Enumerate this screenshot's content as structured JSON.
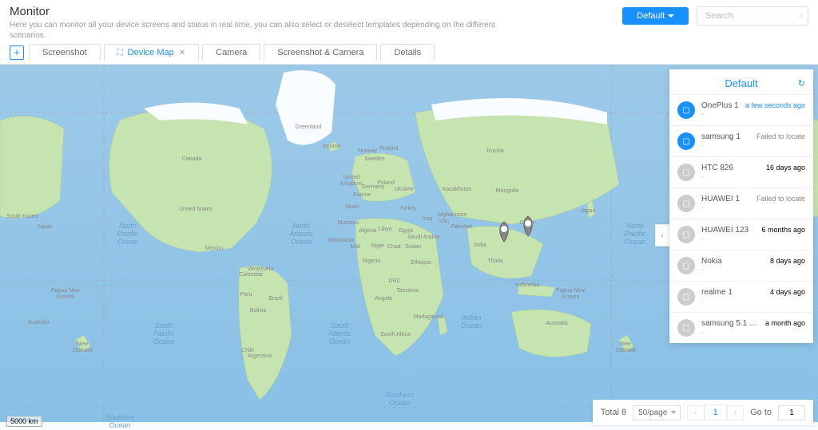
{
  "header": {
    "title": "Monitor",
    "subtitle": "Here you can monitor all your device screens and status in real time, you can also select or deselect templates depending on the different scenarios.",
    "default_btn": "Default",
    "search_placeholder": "Search"
  },
  "tabs": {
    "screenshot": "Screenshot",
    "device_map": "Device Map",
    "camera": "Camera",
    "screenshot_camera": "Screenshot & Camera",
    "details": "Details"
  },
  "map": {
    "scale": "5000 km",
    "oceans": {
      "npac": "North\nPacific\nOcean",
      "natl": "North\nAtlantic\nOcean",
      "spac": "South\nPacific\nOcean",
      "satl": "South\nAtlantic\nOcean",
      "indian": "Indian\nOcean",
      "npac2": "North\nPacific\nOcean",
      "south1": "Southern\nOcean",
      "south2": "Southern\nOcean"
    },
    "countries": {
      "greenland": "Greenland",
      "canada": "Canada",
      "us": "United States",
      "mexico": "Mexico",
      "brazil": "Brazil",
      "argentina": "Argentina",
      "russia": "Russia",
      "china": "China",
      "india": "India",
      "australia": "Australia",
      "algeria": "Algeria",
      "mali": "Mali",
      "niger": "Niger",
      "sudan": "Sudan",
      "drc": "DRC",
      "kazakhstan": "Kazakhstan",
      "mongolia": "Mongolia",
      "iran": "Iran",
      "saudi": "Saudi Arabia",
      "egypt": "Egypt",
      "libya": "Libya",
      "turkey": "Turkey",
      "ukraine": "Ukraine",
      "france": "France",
      "spain": "Spain",
      "germany": "Germany",
      "uk": "United\nKingdom",
      "poland": "Poland",
      "sweden": "Sweden",
      "norway": "Norway",
      "finland": "Finland",
      "iceland": "Iceland",
      "japan": "Japan",
      "skorea": "South Korea",
      "indonesia": "Indonesia",
      "png": "Papua New\nGuinea",
      "nz": "New\nZealand",
      "nz2": "New\nZealand",
      "chad": "Chad",
      "nigeria": "Nigeria",
      "ethiopia": "Ethiopia",
      "tanzania": "Tanzania",
      "angola": "Angola",
      "safrica": "South Africa",
      "madagascar": "Madagascar",
      "peru": "Peru",
      "bolivia": "Bolivia",
      "colombia": "Colombia",
      "venezuela": "Venezuela",
      "chile": "Chile",
      "pakistan": "Pakistan",
      "afghanistan": "Afghanistan",
      "iraq": "Iraq",
      "thai": "Thaila",
      "morocco": "Morocco",
      "mauritania": "Mauritania"
    }
  },
  "panel": {
    "title": "Default"
  },
  "devices": [
    {
      "name": "OnePlus 1",
      "sub": "-",
      "time": "a few seconds ago",
      "status": "online",
      "time_class": "recent"
    },
    {
      "name": "samsung 1",
      "sub": "-",
      "time": "Failed to locate",
      "status": "online",
      "time_class": "fail"
    },
    {
      "name": "HTC 826",
      "sub": "-",
      "time": "16 days ago",
      "status": "offline",
      "time_class": ""
    },
    {
      "name": "HUAWEI 1",
      "sub": "-",
      "time": "Failed to locate",
      "status": "offline",
      "time_class": "fail"
    },
    {
      "name": "HUAWEI 123",
      "sub": "-",
      "time": "6 months ago",
      "status": "offline",
      "time_class": ""
    },
    {
      "name": "Nokia",
      "sub": "-",
      "time": "8 days ago",
      "status": "offline",
      "time_class": ""
    },
    {
      "name": "realme 1",
      "sub": "-",
      "time": "4 days ago",
      "status": "offline",
      "time_class": ""
    },
    {
      "name": "samsung 5.1 ta...",
      "sub": "-",
      "time": "a month ago",
      "status": "offline",
      "time_class": ""
    }
  ],
  "pager": {
    "total": "Total 8",
    "per_page": "50/page",
    "current": "1",
    "goto_label": "Go to",
    "goto_value": "1"
  }
}
